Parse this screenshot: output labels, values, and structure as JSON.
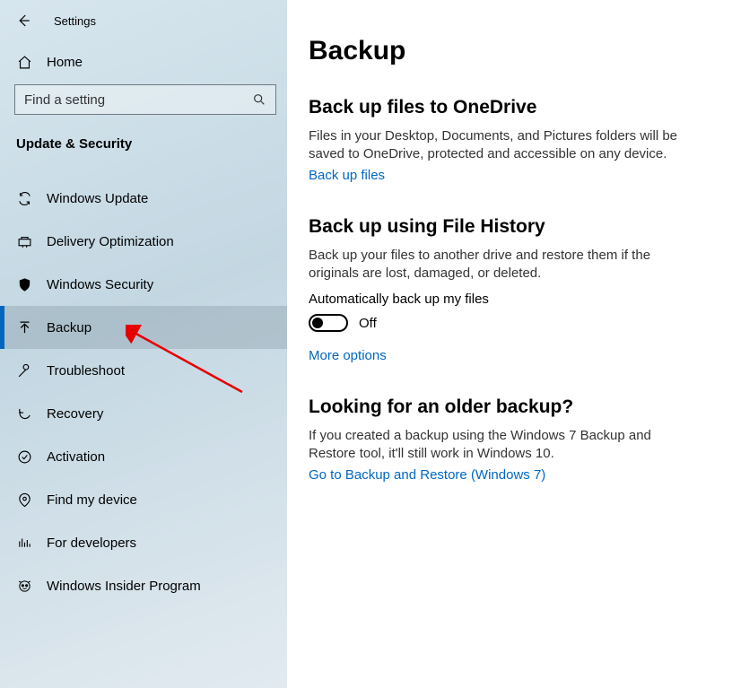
{
  "app_title": "Settings",
  "home_label": "Home",
  "search": {
    "placeholder": "Find a setting"
  },
  "section_label": "Update & Security",
  "sidebar": {
    "items": [
      {
        "label": "Windows Update"
      },
      {
        "label": "Delivery Optimization"
      },
      {
        "label": "Windows Security"
      },
      {
        "label": "Backup"
      },
      {
        "label": "Troubleshoot"
      },
      {
        "label": "Recovery"
      },
      {
        "label": "Activation"
      },
      {
        "label": "Find my device"
      },
      {
        "label": "For developers"
      },
      {
        "label": "Windows Insider Program"
      }
    ]
  },
  "page": {
    "title": "Backup",
    "onedrive": {
      "title": "Back up files to OneDrive",
      "desc": "Files in your Desktop, Documents, and Pictures folders will be saved to OneDrive, protected and accessible on any device.",
      "link": "Back up files"
    },
    "filehistory": {
      "title": "Back up using File History",
      "desc": "Back up your files to another drive and restore them if the originals are lost, damaged, or deleted.",
      "toggle_label": "Automatically back up my files",
      "toggle_state": "Off",
      "more_link": "More options"
    },
    "older": {
      "title": "Looking for an older backup?",
      "desc": "If you created a backup using the Windows 7 Backup and Restore tool, it'll still work in Windows 10.",
      "link": "Go to Backup and Restore (Windows 7)"
    }
  }
}
